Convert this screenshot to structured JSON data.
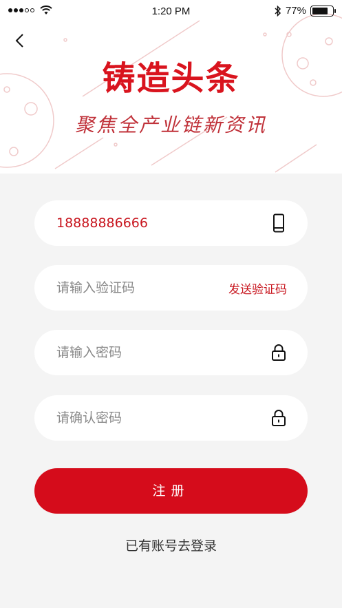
{
  "status_bar": {
    "time": "1:20 PM",
    "battery": "77%",
    "battery_level": 0.77,
    "icons": [
      "signal-dots-icon",
      "wifi-icon",
      "bluetooth-icon",
      "battery-icon"
    ]
  },
  "header": {
    "back_icon": "chevron-left-icon",
    "logo_text": "铸造头条",
    "slogan": "聚焦全产业链新资讯",
    "brand_color": "#d9141e"
  },
  "form": {
    "phone": {
      "value": "18888886666",
      "icon": "mobile-phone-icon"
    },
    "code": {
      "placeholder": "请输入验证码",
      "send_label": "发送验证码"
    },
    "password": {
      "placeholder": "请输入密码",
      "icon": "lock-icon"
    },
    "confirm_password": {
      "placeholder": "请确认密码",
      "icon": "lock-icon"
    },
    "submit_label": "注册",
    "login_link": "已有账号去登录"
  },
  "colors": {
    "accent": "#d50c1b",
    "page_bg": "#f4f4f4",
    "field_bg": "#ffffff",
    "placeholder": "#8a8a8a"
  }
}
